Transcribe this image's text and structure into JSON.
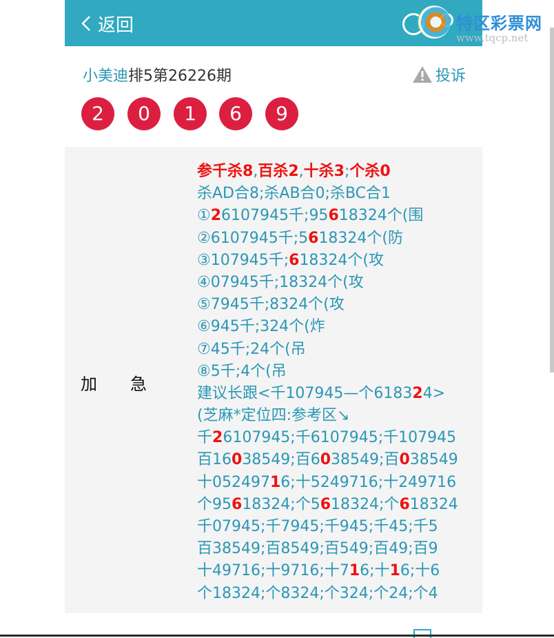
{
  "header": {
    "back_label": "返回"
  },
  "watermark": {
    "title": "特区彩票网",
    "url": "www.tqcp.net"
  },
  "post": {
    "author": "小美迪",
    "issue": "排5第26226期",
    "complain_label": "投诉",
    "balls": [
      "2",
      "0",
      "1",
      "6",
      "9"
    ],
    "label": "加　　急"
  },
  "content_lines": [
    [
      {
        "t": "参千杀8",
        "r": true
      },
      {
        "t": ","
      },
      {
        "t": "百杀2",
        "r": true
      },
      {
        "t": ","
      },
      {
        "t": "十杀3",
        "r": true
      },
      {
        "t": ";"
      },
      {
        "t": "个杀0",
        "r": true
      }
    ],
    [
      {
        "t": "杀AD合8;杀AB合0;杀BC合1"
      }
    ],
    [
      {
        "t": "①"
      },
      {
        "t": "2",
        "r": true
      },
      {
        "t": "6107945千;95"
      },
      {
        "t": "6",
        "r": true
      },
      {
        "t": "18324个(围"
      }
    ],
    [
      {
        "t": "②6107945千;5"
      },
      {
        "t": "6",
        "r": true
      },
      {
        "t": "18324个(防"
      }
    ],
    [
      {
        "t": "③107945千;"
      },
      {
        "t": "6",
        "r": true
      },
      {
        "t": "18324个(攻"
      }
    ],
    [
      {
        "t": "④07945千;18324个(攻"
      }
    ],
    [
      {
        "t": "⑤7945千;8324个(攻"
      }
    ],
    [
      {
        "t": "⑥945千;324个(炸"
      }
    ],
    [
      {
        "t": "⑦45千;24个(吊"
      }
    ],
    [
      {
        "t": "⑧5千;4个(吊"
      }
    ],
    [
      {
        "t": "建议长跟<千107945—个6183"
      },
      {
        "t": "2",
        "r": true
      },
      {
        "t": "4>"
      }
    ],
    [
      {
        "t": "(芝麻*定位四:参考区↘"
      }
    ],
    [
      {
        "t": "千"
      },
      {
        "t": "2",
        "r": true
      },
      {
        "t": "6107945;千6107945;千107945"
      }
    ],
    [
      {
        "t": "百16"
      },
      {
        "t": "0",
        "r": true
      },
      {
        "t": "38549;百6"
      },
      {
        "t": "0",
        "r": true
      },
      {
        "t": "38549;百"
      },
      {
        "t": "0",
        "r": true
      },
      {
        "t": "38549"
      }
    ],
    [
      {
        "t": "十052497"
      },
      {
        "t": "1",
        "r": true
      },
      {
        "t": "6;十524971"
      },
      {
        "t": "6;十24971",
        "r": false
      },
      {
        "t": "6"
      }
    ],
    [
      {
        "t": "个95"
      },
      {
        "t": "6",
        "r": true
      },
      {
        "t": "18324;个5"
      },
      {
        "t": "6",
        "r": true
      },
      {
        "t": "18324;个"
      },
      {
        "t": "6",
        "r": true
      },
      {
        "t": "18324"
      }
    ],
    [
      {
        "t": "千07945;千7945;千945;千45;千5"
      }
    ],
    [
      {
        "t": "百38549;百8549;百549;百49;百9"
      }
    ],
    [
      {
        "t": "十4971"
      },
      {
        "t": "6;十971",
        "r": false
      },
      {
        "t": "6;十7"
      },
      {
        "t": "1",
        "r": true
      },
      {
        "t": "6;十"
      },
      {
        "t": "1",
        "r": true
      },
      {
        "t": "6;十6"
      }
    ],
    [
      {
        "t": "个18324;个8324;个324;个24;个4"
      }
    ]
  ],
  "colors": {
    "header": "#30a9c1",
    "ball": "#dc1f41",
    "accent_text": "#2b97b5",
    "highlight": "#ee1111"
  }
}
